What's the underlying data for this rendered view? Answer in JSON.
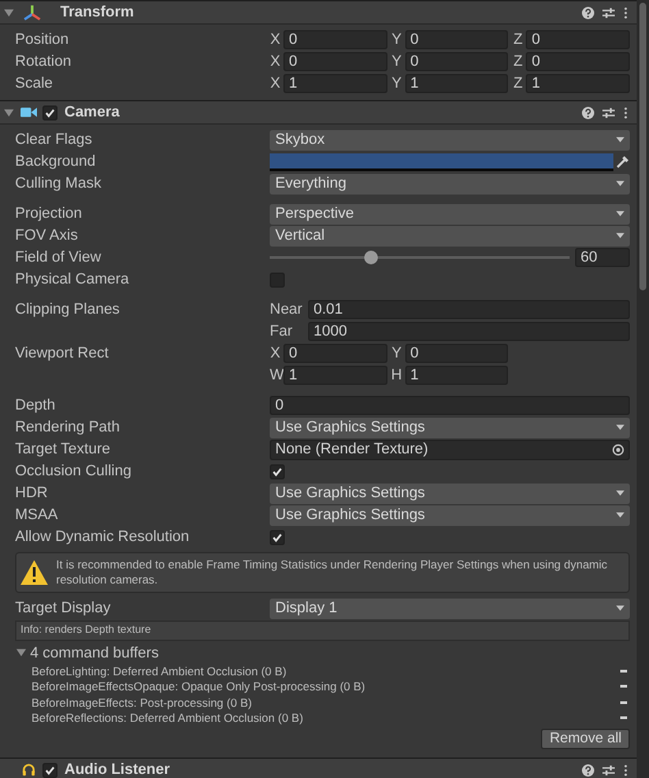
{
  "components": [
    {
      "kind": "transform",
      "title": "Transform",
      "expanded": true,
      "groups": [
        [
          {
            "kind": "vector",
            "label": "Position",
            "fields": [
              {
                "axis": "X",
                "value": "0"
              },
              {
                "axis": "Y",
                "value": "0"
              },
              {
                "axis": "Z",
                "value": "0"
              }
            ]
          },
          {
            "kind": "vector",
            "label": "Rotation",
            "fields": [
              {
                "axis": "X",
                "value": "0"
              },
              {
                "axis": "Y",
                "value": "0"
              },
              {
                "axis": "Z",
                "value": "0"
              }
            ]
          },
          {
            "kind": "vector",
            "label": "Scale",
            "fields": [
              {
                "axis": "X",
                "value": "1"
              },
              {
                "axis": "Y",
                "value": "1"
              },
              {
                "axis": "Z",
                "value": "1"
              }
            ]
          }
        ]
      ]
    },
    {
      "kind": "camera",
      "title": "Camera",
      "enabled": true,
      "expanded": true,
      "groups": [
        [
          {
            "kind": "dropdown",
            "label": "Clear Flags",
            "value": "Skybox"
          },
          {
            "kind": "color",
            "label": "Background",
            "color": "#2f5285"
          },
          {
            "kind": "dropdown",
            "label": "Culling Mask",
            "value": "Everything"
          }
        ],
        [
          {
            "kind": "dropdown",
            "label": "Projection",
            "value": "Perspective"
          },
          {
            "kind": "dropdown",
            "label": "FOV Axis",
            "value": "Vertical"
          },
          {
            "kind": "slider",
            "label": "Field of View",
            "level": 0.34,
            "value": "60"
          },
          {
            "kind": "checkbox",
            "label": "Physical Camera",
            "checked": false
          }
        ],
        [
          {
            "kind": "pair",
            "label": "Clipping Planes",
            "fields": [
              {
                "axis": "Near",
                "value": "0.01"
              },
              {
                "axis": "Far",
                "value": "1000"
              }
            ]
          },
          {
            "kind": "rect",
            "label": "Viewport Rect",
            "fields": [
              {
                "axis": "X",
                "value": "0"
              },
              {
                "axis": "Y",
                "value": "0"
              },
              {
                "axis": "W",
                "value": "1"
              },
              {
                "axis": "H",
                "value": "1"
              }
            ]
          }
        ],
        [
          {
            "kind": "number",
            "label": "Depth",
            "value": "0"
          },
          {
            "kind": "dropdown",
            "label": "Rendering Path",
            "value": "Use Graphics Settings"
          },
          {
            "kind": "object",
            "label": "Target Texture",
            "value": "None (Render Texture)"
          },
          {
            "kind": "checkbox",
            "label": "Occlusion Culling",
            "checked": true
          },
          {
            "kind": "dropdown",
            "label": "HDR",
            "value": "Use Graphics Settings"
          },
          {
            "kind": "dropdown",
            "label": "MSAA",
            "value": "Use Graphics Settings"
          },
          {
            "kind": "checkbox",
            "label": "Allow Dynamic Resolution",
            "checked": true
          },
          {
            "kind": "warning",
            "text": "It is recommended to enable Frame Timing Statistics under Rendering Player Settings when using dynamic resolution cameras."
          },
          {
            "kind": "dropdown",
            "label": "Target Display",
            "value": "Display 1"
          },
          {
            "kind": "info",
            "text": "Info: renders Depth texture"
          },
          {
            "kind": "buffers",
            "label": "4 command buffers",
            "expanded": true,
            "items": [
              "BeforeLighting: Deferred Ambient Occlusion (0 B)",
              "BeforeImageEffectsOpaque: Opaque Only Post-processing (0 B)",
              "BeforeImageEffects: Post-processing (0 B)",
              "BeforeReflections: Deferred Ambient Occlusion (0 B)"
            ],
            "button": "Remove all"
          }
        ]
      ]
    },
    {
      "kind": "audio",
      "title": "Audio Listener",
      "enabled": true
    }
  ]
}
